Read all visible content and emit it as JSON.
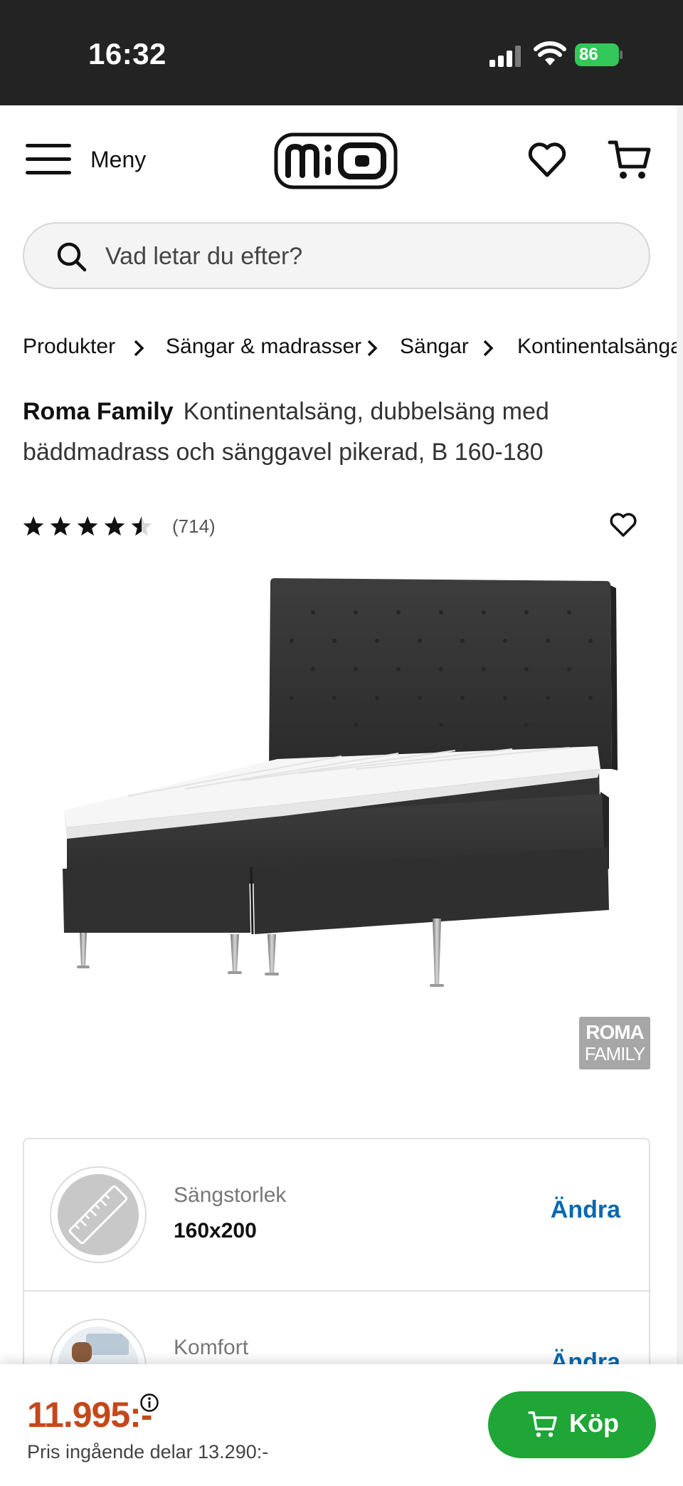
{
  "status_bar": {
    "time": "16:32",
    "battery": "86"
  },
  "header": {
    "menu_label": "Meny",
    "logo_text": "mio"
  },
  "search": {
    "placeholder": "Vad letar du efter?"
  },
  "breadcrumb": [
    "Produkter",
    "Sängar & madrasser",
    "Sängar",
    "Kontinentalsängar"
  ],
  "product": {
    "brand": "Roma Family",
    "title": "Kontinentalsäng, dubbelsäng med bäddmadrass och sänggavel pikerad, B 160-180",
    "rating": 4.5,
    "review_count": "(714)",
    "badge_line1": "ROMA",
    "badge_line2": "FAMILY"
  },
  "options": [
    {
      "label": "Sängstorlek",
      "value": "160x200",
      "change_label": "Ändra",
      "icon": "ruler-icon"
    },
    {
      "label": "Komfort",
      "value": "",
      "change_label": "Ändra",
      "icon": "mattress-icon"
    }
  ],
  "bottom_bar": {
    "price": "11.995:-",
    "price_note": "Pris ingående delar 13.290:-",
    "buy_label": "Köp"
  },
  "colors": {
    "accent_blue": "#0a68ad",
    "price": "#c4481b",
    "buy": "#1fa636"
  }
}
